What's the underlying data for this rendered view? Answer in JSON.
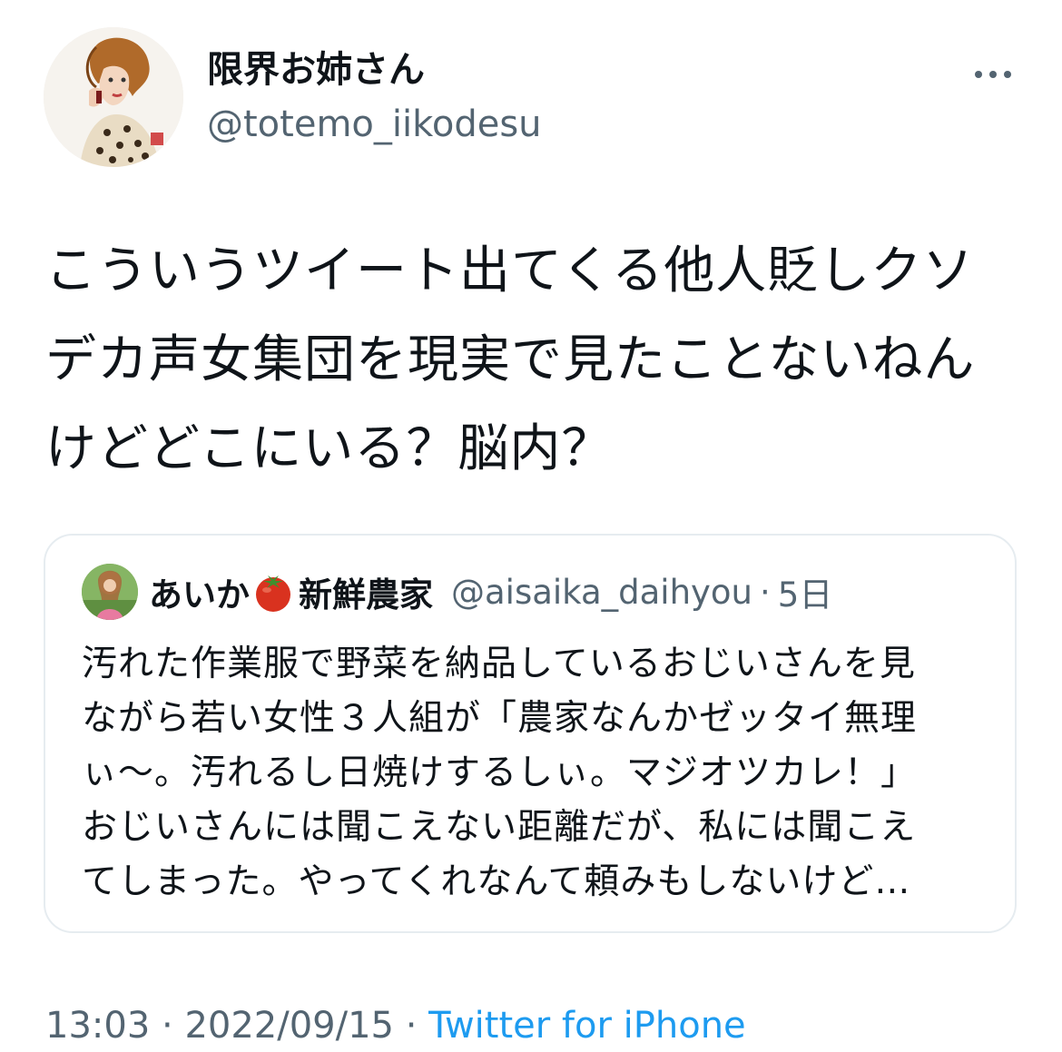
{
  "author": {
    "name": "限界お姉さん",
    "handle": "@totemo_iikodesu",
    "avatar_icon": "avatar-illustration"
  },
  "tweet": {
    "text": "こういうツイート出てくる他人貶しクソデカ声女集団を現実で見たことないねんけどどこにいる？脳内？"
  },
  "quoted_tweet": {
    "name_prefix": "あいか",
    "name_emoji": "tomato-emoji",
    "name_suffix": "新鮮農家",
    "handle": "@aisaika_daihyou",
    "separator": "·",
    "time": "5日",
    "text": "汚れた作業服で野菜を納品しているおじいさんを見\nながら若い女性３人組が「農家なんかゼッタイ無理\nぃ〜。汚れるし日焼けするしぃ。マジオツカレ！」\nおじいさんには聞こえない距離だが、私には聞こえ\nてしまった。やってくれなんて頼みもしないけど…"
  },
  "footer": {
    "time": "13:03",
    "sep1": " · ",
    "date": "2022/09/15",
    "sep2": " · ",
    "source": "Twitter for iPhone"
  },
  "colors": {
    "text": "#0f1419",
    "secondary": "#536471",
    "link": "#1d9bf0",
    "border": "#e6ecf0"
  },
  "more_icon": "more-horizontal-icon"
}
